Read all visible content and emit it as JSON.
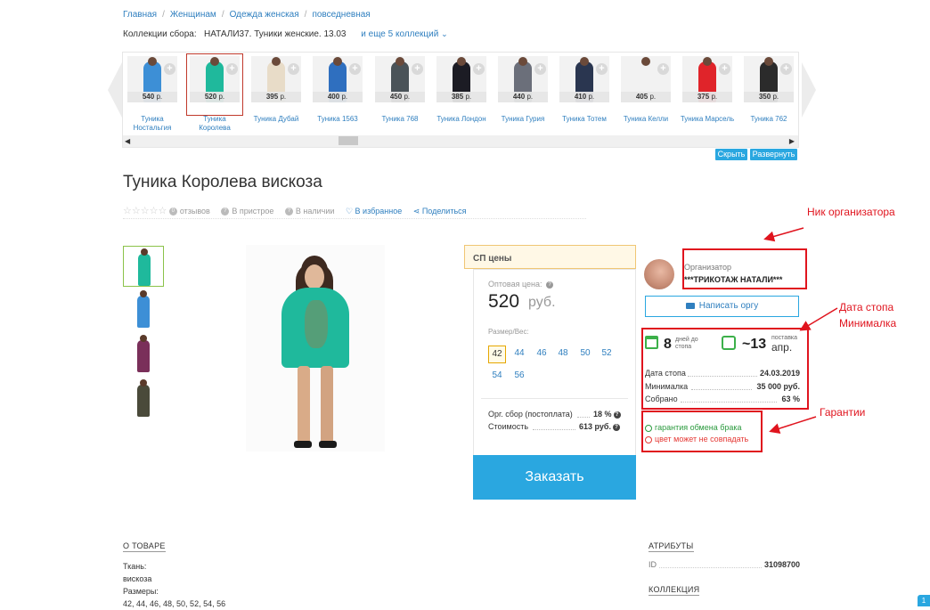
{
  "breadcrumbs": [
    "Главная",
    "Женщинам",
    "Одежда женская",
    "повседневная"
  ],
  "collections": {
    "label": "Коллекции сбора:",
    "current": "НАТАЛИ37. Туники женские. 13.03",
    "more": "и еще 5 коллекций"
  },
  "carousel": {
    "items": [
      {
        "price": "540",
        "unit": "р.",
        "name": "Туника Ностальгия",
        "color": "#3d8fd6"
      },
      {
        "price": "520",
        "unit": "р.",
        "name": "Туника Королева",
        "color": "#1fb99c"
      },
      {
        "price": "395",
        "unit": "р.",
        "name": "Туника Дубай",
        "color": "#e8dcc8"
      },
      {
        "price": "400",
        "unit": "р.",
        "name": "Туника 1563",
        "color": "#2f6fbf"
      },
      {
        "price": "450",
        "unit": "р.",
        "name": "Туника 768",
        "color": "#4a5358"
      },
      {
        "price": "385",
        "unit": "р.",
        "name": "Туника Лондон",
        "color": "#1c1c24"
      },
      {
        "price": "440",
        "unit": "р.",
        "name": "Туника Гурия",
        "color": "#6b6f7a"
      },
      {
        "price": "410",
        "unit": "р.",
        "name": "Туника Тотем",
        "color": "#2a3650"
      },
      {
        "price": "405",
        "unit": "р.",
        "name": "Туника Келли",
        "color": "#f2f2f2"
      },
      {
        "price": "375",
        "unit": "р.",
        "name": "Туника Марсель",
        "color": "#e0242a"
      },
      {
        "price": "350",
        "unit": "р.",
        "name": "Туника 762",
        "color": "#2b2b2b"
      }
    ],
    "hide_label": "Скрыть",
    "expand_label": "Развернуть"
  },
  "product": {
    "title": "Туника Королева вискоза",
    "reviews": "отзывов",
    "fitting": "В пристрое",
    "stock": "В наличии",
    "favorite": "В избранное",
    "share": "Поделиться"
  },
  "gallery": [
    {
      "color": "#1fb99c"
    },
    {
      "color": "#3d8fd6"
    },
    {
      "color": "#7a2f5a"
    },
    {
      "color": "#4a4a3a"
    }
  ],
  "pricing": {
    "tab": "СП цены",
    "opt_label": "Оптовая цена:",
    "price": "520",
    "currency": "руб.",
    "size_label": "Размер/Вес:",
    "sizes": [
      "42",
      "44",
      "46",
      "48",
      "50",
      "52",
      "54",
      "56"
    ],
    "fee_label": "Орг. сбор (постоплата)",
    "fee_value": "18 %",
    "cost_label": "Стоимость",
    "cost_value": "613 руб.",
    "order_label": "Заказать"
  },
  "organizer": {
    "label": "Организатор",
    "name": "***ТРИКОТАЖ НАТАЛИ***",
    "message_label": "Написать оргу"
  },
  "stop": {
    "days": "8",
    "days_label": "дней до стопа",
    "ship": "~13",
    "ship_label": "поставка",
    "ship_date": "апр.",
    "rows": [
      {
        "label": "Дата стопа",
        "value": "24.03.2019"
      },
      {
        "label": "Минималка",
        "value": "35 000 руб."
      },
      {
        "label": "Собрано",
        "value": "63 %"
      }
    ]
  },
  "guarantee": {
    "ok": "гарантия обмена брака",
    "warn": "цвет может не совпадать"
  },
  "about": {
    "title": "О ТОВАРЕ",
    "lines": [
      "Ткань:",
      "вискоза",
      "Размеры:",
      "42, 44, 46, 48, 50, 52, 54, 56"
    ]
  },
  "attributes": {
    "title": "АТРИБУТЫ",
    "id_label": "ID",
    "id_value": "31098700",
    "collection_title": "КОЛЛЕКЦИЯ"
  },
  "annotations": {
    "organizer": "Ник организатора",
    "stop_line1": "Дата стопа",
    "stop_line2": "Минималка",
    "guarantee": "Гарантии"
  }
}
